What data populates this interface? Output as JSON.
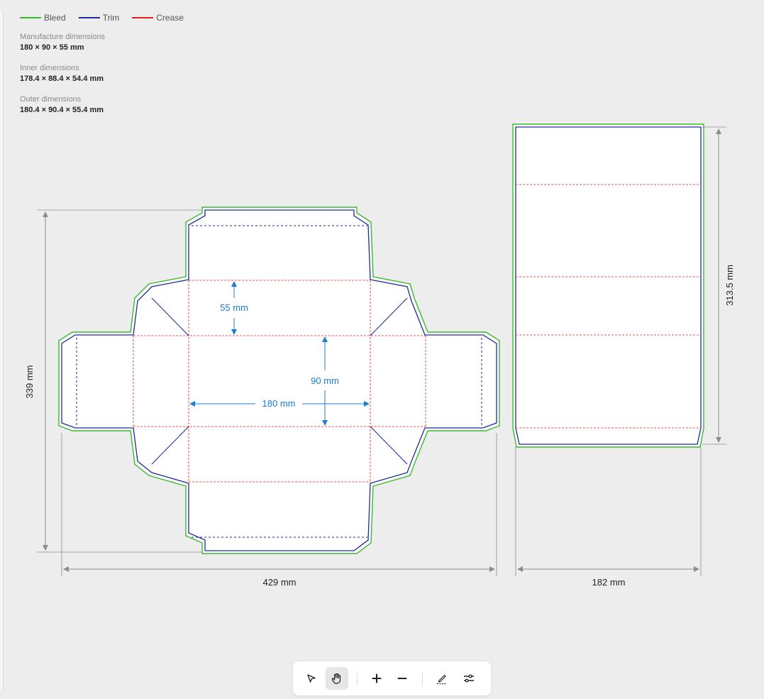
{
  "legend": [
    {
      "label": "Bleed",
      "color": "#3cb82e"
    },
    {
      "label": "Trim",
      "color": "#1e2a9c"
    },
    {
      "label": "Crease",
      "color": "#e02020"
    }
  ],
  "specs": {
    "manufacture": {
      "label": "Manufacture dimensions",
      "value": "180 × 90 × 55 mm"
    },
    "inner": {
      "label": "Inner dimensions",
      "value": "178.4 × 88.4 × 54.4 mm"
    },
    "outer": {
      "label": "Outer dimensions",
      "value": "180.4 × 90.4 × 55.4 mm"
    }
  },
  "dieline": {
    "overall_height": "339 mm",
    "overall_width": "429 mm",
    "depth_label": "55 mm",
    "inner_height_label": "90 mm",
    "inner_width_label": "180 mm"
  },
  "sleeve": {
    "height": "313.5 mm",
    "width": "182 mm"
  },
  "colors": {
    "bleed": "#3cb82e",
    "trim": "#1e2a9c",
    "crease": "#e02020",
    "dimension": "#1a7fd4",
    "measure": "#8c8c8c"
  },
  "toolbar": {
    "tools": [
      {
        "name": "select-tool",
        "icon": "pointer-icon",
        "active": false
      },
      {
        "name": "pan-tool",
        "icon": "hand-icon",
        "active": true
      },
      {
        "name": "zoom-in-tool",
        "icon": "plus-icon",
        "active": false
      },
      {
        "name": "zoom-out-tool",
        "icon": "minus-icon",
        "active": false
      },
      {
        "name": "annotate-tool",
        "icon": "pen-icon",
        "active": false
      },
      {
        "name": "settings-tool",
        "icon": "sliders-icon",
        "active": false
      }
    ]
  }
}
